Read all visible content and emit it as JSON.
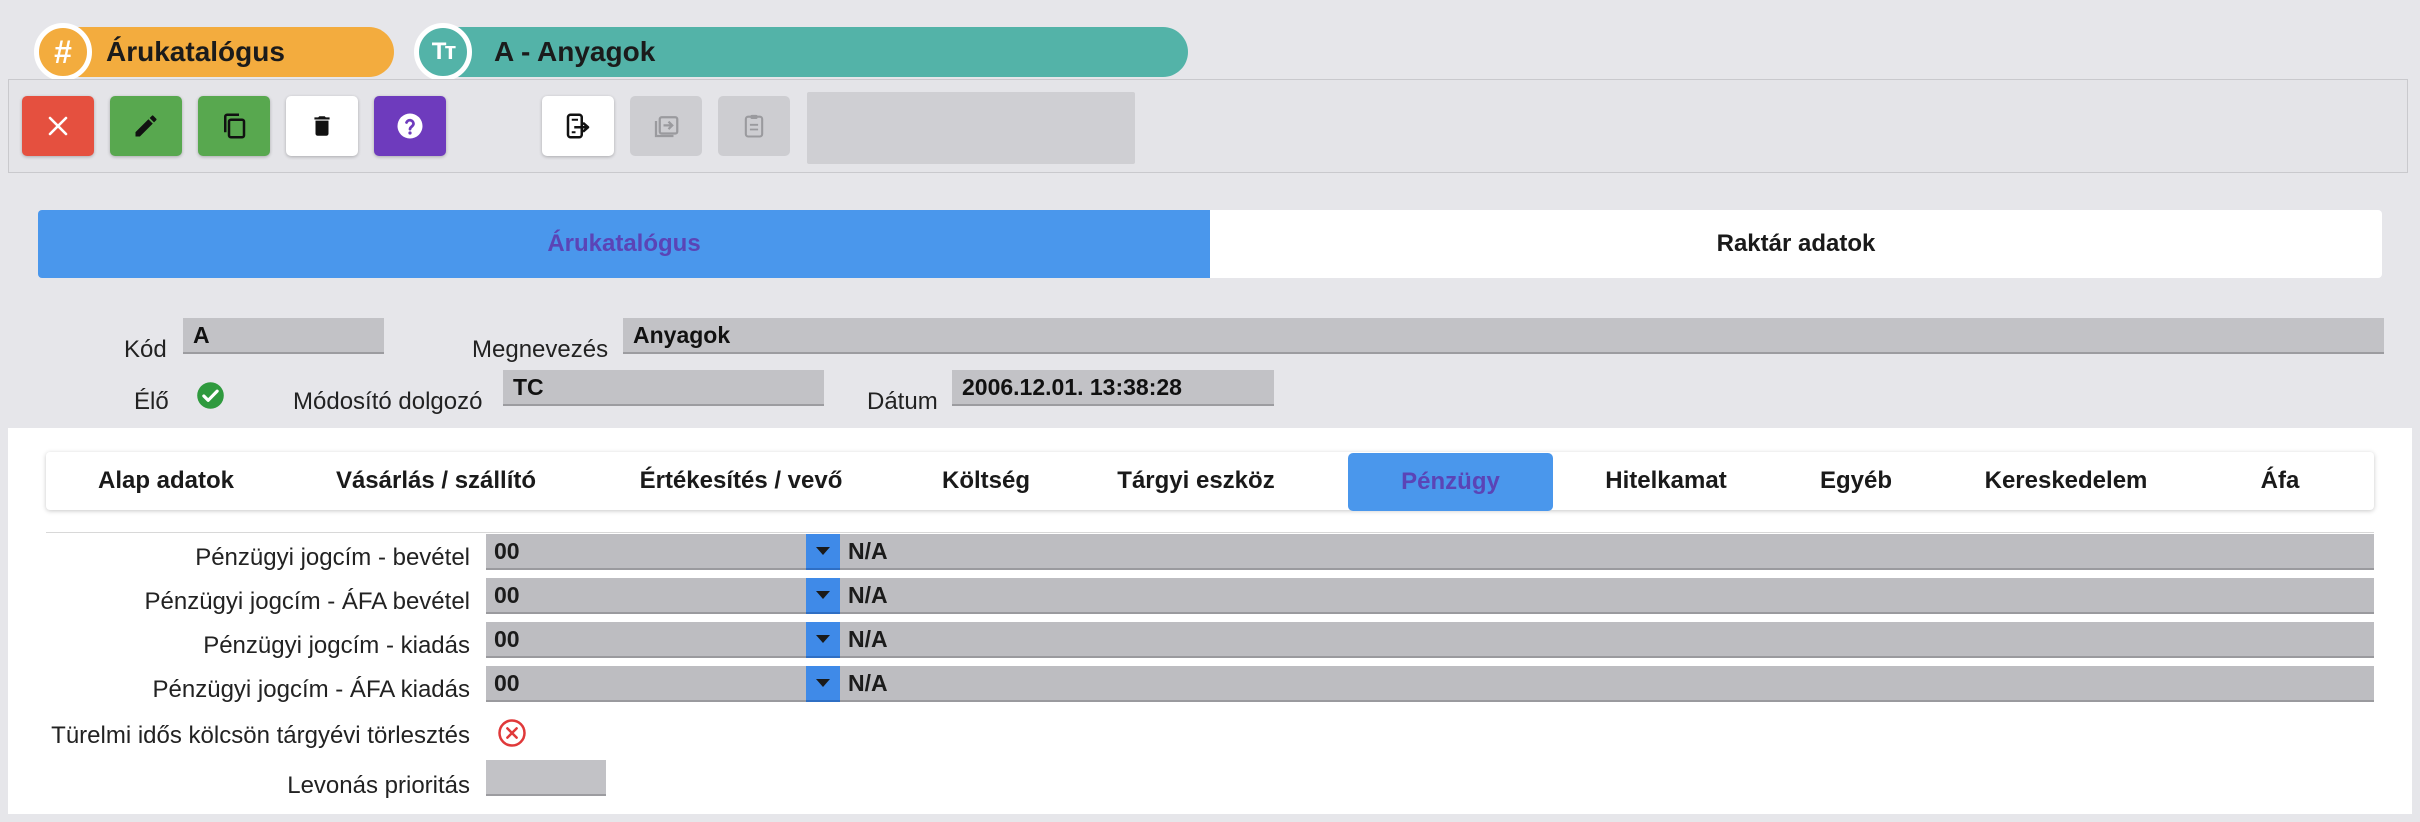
{
  "header": {
    "module_title": "Árukatalógus",
    "module_icon": "hash-icon",
    "record_title": "A - Anyagok",
    "record_icon": "text-type-icon"
  },
  "toolbar": {
    "buttons": [
      {
        "name": "close",
        "icon": "close-icon",
        "color": "#e5503f"
      },
      {
        "name": "edit",
        "icon": "pencil-icon",
        "color": "#58a84f"
      },
      {
        "name": "copy",
        "icon": "copy-icon",
        "color": "#58a84f"
      },
      {
        "name": "delete",
        "icon": "trash-icon",
        "color": "#ffffff"
      },
      {
        "name": "help",
        "icon": "help-icon",
        "color": "#6e3bbd"
      },
      {
        "name": "export",
        "icon": "export-icon",
        "color": "#ffffff"
      },
      {
        "name": "import",
        "icon": "import-icon",
        "color": "#cdcdd1"
      },
      {
        "name": "paste",
        "icon": "clipboard-icon",
        "color": "#cdcdd1"
      }
    ]
  },
  "main_tabs": [
    {
      "label": "Árukatalógus",
      "active": true
    },
    {
      "label": "Raktár adatok",
      "active": false
    }
  ],
  "form": {
    "kod_label": "Kód",
    "kod_value": "A",
    "megnevezes_label": "Megnevezés",
    "megnevezes_value": "Anyagok",
    "elo_label": "Élő",
    "elo_value": true,
    "modosito_label": "Módosító dolgozó",
    "modosito_value": "TC",
    "datum_label": "Dátum",
    "datum_value": "2006.12.01. 13:38:28"
  },
  "sub_tabs": [
    {
      "label": "Alap adatok",
      "active": false
    },
    {
      "label": "Vásárlás / szállító",
      "active": false
    },
    {
      "label": "Értékesítés / vevő",
      "active": false
    },
    {
      "label": "Költség",
      "active": false
    },
    {
      "label": "Tárgyi eszköz",
      "active": false
    },
    {
      "label": "Pénzügy",
      "active": true
    },
    {
      "label": "Hitelkamat",
      "active": false
    },
    {
      "label": "Egyéb",
      "active": false
    },
    {
      "label": "Kereskedelem",
      "active": false
    },
    {
      "label": "Áfa",
      "active": false
    }
  ],
  "penzugy": {
    "rows": [
      {
        "label": "Pénzügyi jogcím - bevétel",
        "code": "00",
        "desc": "N/A"
      },
      {
        "label": "Pénzügyi jogcím - ÁFA bevétel",
        "code": "00",
        "desc": "N/A"
      },
      {
        "label": "Pénzügyi jogcím - kiadás",
        "code": "00",
        "desc": "N/A"
      },
      {
        "label": "Pénzügyi jogcím - ÁFA kiadás",
        "code": "00",
        "desc": "N/A"
      }
    ],
    "turelmi_label": "Türelmi idős kölcsön tárgyévi törlesztés",
    "turelmi_value": false,
    "levonas_label": "Levonás prioritás",
    "levonas_value": ""
  },
  "colors": {
    "accent_blue": "#4a97ec",
    "orange": "#f3ac3e",
    "teal": "#53b3a8",
    "red": "#e5503f",
    "green": "#58a84f",
    "purple": "#6e3bbd"
  }
}
